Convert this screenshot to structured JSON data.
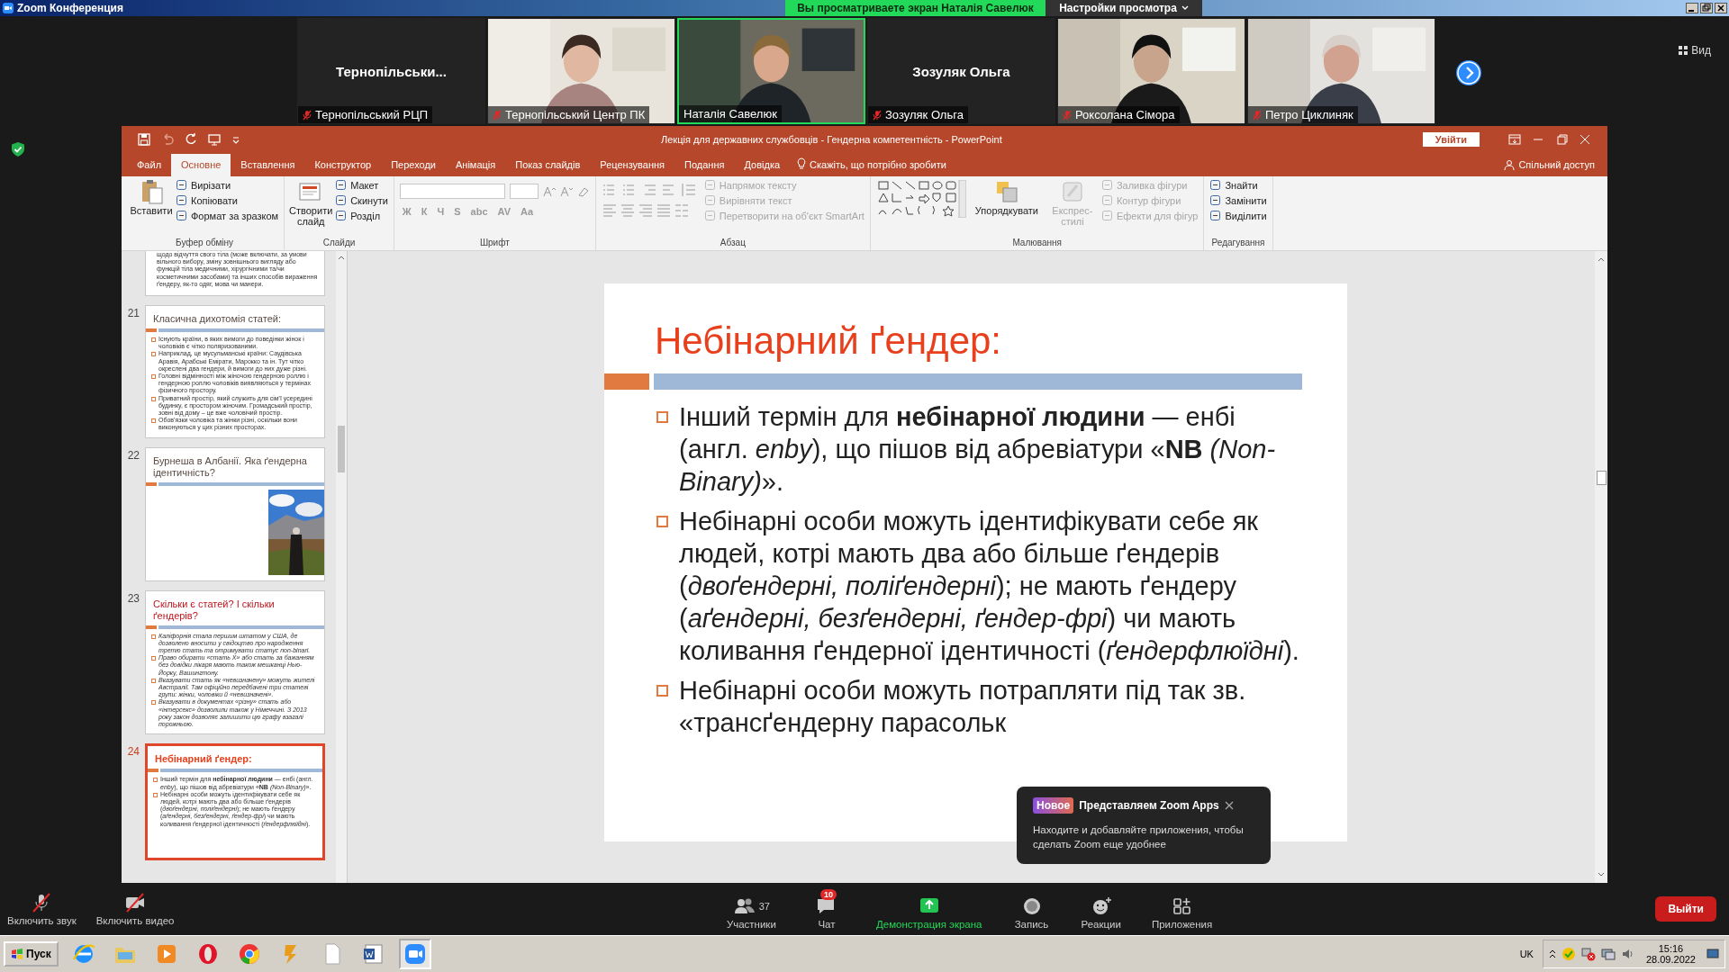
{
  "zoom_window": {
    "title": "Zoom Конференция",
    "share_banner": "Вы просматриваете экран Наталія Савелюк",
    "view_settings": "Настройки просмотра",
    "view_button": "Вид"
  },
  "participants": [
    {
      "kind": "name",
      "name": "Тернопільськи...",
      "label": "Тернопільський РЦП",
      "muted": true,
      "speaking": false
    },
    {
      "kind": "picture",
      "label": "Тернопільський Центр ПК",
      "muted": true,
      "speaking": false
    },
    {
      "kind": "picture",
      "label": "Наталія Савелюк",
      "muted": false,
      "speaking": true
    },
    {
      "kind": "name",
      "name": "Зозуляк Ольга",
      "label": "Зозуляк Ольга",
      "muted": true,
      "speaking": false
    },
    {
      "kind": "picture",
      "label": "Роксолана Сімора",
      "muted": true,
      "speaking": false
    },
    {
      "kind": "picture",
      "label": "Петро Циклиняк",
      "muted": true,
      "speaking": false
    }
  ],
  "powerpoint": {
    "title": "Лекція для державних службовців - Гендерна компетентність - PowerPoint",
    "signin": "Увійти",
    "tabs": [
      {
        "label": "Файл",
        "selected": false
      },
      {
        "label": "Основне",
        "selected": true
      },
      {
        "label": "Вставлення",
        "selected": false
      },
      {
        "label": "Конструктор",
        "selected": false
      },
      {
        "label": "Переходи",
        "selected": false
      },
      {
        "label": "Анімація",
        "selected": false
      },
      {
        "label": "Показ слайдів",
        "selected": false
      },
      {
        "label": "Рецензування",
        "selected": false
      },
      {
        "label": "Подання",
        "selected": false
      },
      {
        "label": "Довідка",
        "selected": false
      }
    ],
    "tell_me": "Скажіть, що потрібно зробити",
    "share": "Спільний доступ",
    "ribbon": [
      {
        "kind": "clipboard",
        "label": "Буфер обміну",
        "large": [
          {
            "label": "Вставити",
            "disabled": false
          }
        ],
        "small": [
          {
            "label": "Вирізати",
            "disabled": false
          },
          {
            "label": "Копіювати",
            "disabled": false
          },
          {
            "label": "Формат за зразком",
            "disabled": false
          }
        ]
      },
      {
        "kind": "slides",
        "label": "Слайди",
        "large": [
          {
            "label": "Створити слайд",
            "disabled": false
          }
        ],
        "small": [
          {
            "label": "Макет",
            "disabled": false
          },
          {
            "label": "Скинути",
            "disabled": false
          },
          {
            "label": "Розділ",
            "disabled": false
          }
        ]
      },
      {
        "kind": "font",
        "label": "Шрифт",
        "font_buttons": [
          "Ж",
          "К",
          "Ч",
          "S",
          "abc",
          "AV",
          "Aa"
        ]
      },
      {
        "kind": "paragraph",
        "label": "Абзац",
        "small": [
          {
            "label": "Напрямок тексту",
            "disabled": true
          },
          {
            "label": "Вирівняти текст",
            "disabled": true
          },
          {
            "label": "Перетворити на об'єкт SmartArt",
            "disabled": true
          }
        ]
      },
      {
        "kind": "drawing",
        "label": "Малювання",
        "large": [
          {
            "label": "Упорядкувати",
            "disabled": false
          },
          {
            "label": "Експрес-стилі",
            "disabled": true
          }
        ],
        "small": [
          {
            "label": "Заливка фігури",
            "disabled": true
          },
          {
            "label": "Контур фігури",
            "disabled": true
          },
          {
            "label": "Ефекти для фігур",
            "disabled": true
          }
        ]
      },
      {
        "kind": "editing",
        "label": "Редагування",
        "small": [
          {
            "label": "Знайти",
            "disabled": false
          },
          {
            "label": "Замінити",
            "disabled": false
          },
          {
            "label": "Виділити",
            "disabled": false
          }
        ]
      }
    ],
    "thumbnails": [
      {
        "kind": "text",
        "selected": false,
        "cut": true,
        "italic": false,
        "bullets": [
          "щодо відчуття свого тіла (може включати, за умови вільного вибору, зміну зовнішнього вигляду або функцій тіла медичними, хірургічними та/чи косметичними засобами) та інших способів вираження ґендеру, як-то одяг, мова чи манери."
        ]
      },
      {
        "number": "21",
        "kind": "text",
        "selected": false,
        "cut": false,
        "color": "#5a4a42",
        "italic": false,
        "title": "Класична дихотомія статей:",
        "bullets": [
          "Існують країни, в яких вимоги до поведінки жінок і чоловіків є чітко поляризованими.",
          "Наприклад, це мусульманські країни: Саудівська Аравія, Арабські Емірати, Марокко та ін. Тут чітко окреслені два гендери, й вимоги до них дуже різні.",
          "Головні відмінності між жіночою гендерною роллю і гендерною роллю чоловіків виявляються у термінах фізичного простору.",
          "Приватний простір, який служить для сім'ї усередині будинку, є простором жіночим. Громадський простір, зовні від дому – це вже чоловічий простір.",
          "Обов'язки чоловіка та жінки різні, оскільки вони виконуються у цих різних просторах."
        ]
      },
      {
        "number": "22",
        "kind": "picture",
        "selected": false,
        "cut": false,
        "color": "#5a4a42",
        "title": "Бурнеша в Албанії. Яка ґендерна ідентичність?"
      },
      {
        "number": "23",
        "kind": "text",
        "selected": false,
        "cut": false,
        "color": "#c0161e",
        "italic": true,
        "title": "Скільки є статей? І скільки ґендерів?",
        "bullets": [
          "Каліфорнія стала першим штатом у США, де дозволено вносити у свідоцтво про народження третю стать та отримувати статус non-binari.",
          "Право обирати «стать Х» або стать за бажанням без довідки лікаря мають також мешканці Нью-Йорку, Вашингтону.",
          "Вказувати стать як «невизначену» можуть жителі Австралії. Там офіційно передбачені три статеві групи: жінки, чоловіки й «невизначені».",
          "Вказувати в документах «різну» стать або «інтерсекс» дозволили також у Німеччині. З 2013 року закон дозволяє залишити цю графу взагалі порожньою."
        ]
      },
      {
        "number": "24",
        "kind": "text",
        "selected": true,
        "cut": false,
        "color": "#e8401c",
        "italic": false,
        "title": "Небінарний ґендер:",
        "bullets": [
          "Інший термін для **небінарної людини** — енбі (англ. *enby*), що пішов від абревіатури «**NB** *(Non-Binary)*».",
          "Небінарні особи можуть ідентифікувати себе як людей, котрі мають два або більше ґендерів (*двоґендерні, поліґендерні*); не мають ґендеру (*аґендерні, безґендерні, ґендер-фрі*) чи мають коливання ґендерної ідентичності (*ґендерфлюїдні*)."
        ]
      }
    ],
    "slide": {
      "title": "Небінарний ґендер:",
      "bullets": [
        "Інший термін для **небінарної людини** — енбі (англ. *enby*), що пішов від абревіатури «**NB** *(Non-Binary)*».",
        "Небінарні особи можуть ідентифікувати себе як людей, котрі мають два або більше ґендерів (*двоґендерні, поліґендерні*); не мають ґендеру (*аґендерні, безґендерні, ґендер-фрі*) чи мають коливання ґендерної ідентичності (*ґендерфлюїдні*).",
        "Небінарні особи можуть потрапляти під так зв. «трансґендерну парасольк"
      ]
    }
  },
  "popup": {
    "badge": "Новое",
    "title": "Представляем Zoom Apps",
    "text": "Находите и добавляйте приложения, чтобы сделать Zoom еще удобнее"
  },
  "toolbar": [
    {
      "kind": "mic",
      "label": "Включить звук",
      "muted": true
    },
    {
      "kind": "video",
      "label": "Включить видео",
      "muted": true
    },
    {
      "kind": "participants",
      "label": "Участники",
      "count": "37"
    },
    {
      "kind": "chat",
      "label": "Чат",
      "badge": "10"
    },
    {
      "kind": "share",
      "label": "Демонстрация экрана"
    },
    {
      "kind": "record",
      "label": "Запись"
    },
    {
      "kind": "reactions",
      "label": "Реакции"
    },
    {
      "kind": "apps",
      "label": "Приложения"
    }
  ],
  "leave_button": "Выйти",
  "taskbar": {
    "start": "Пуск",
    "apps": [
      {
        "kind": "ie"
      },
      {
        "kind": "folder"
      },
      {
        "kind": "media"
      },
      {
        "kind": "opera"
      },
      {
        "kind": "chrome"
      },
      {
        "kind": "archive"
      },
      {
        "kind": "file"
      },
      {
        "kind": "word"
      },
      {
        "kind": "zoom",
        "selected": true
      }
    ],
    "language": "UK",
    "time": "15:16",
    "date": "28.09.2022"
  }
}
